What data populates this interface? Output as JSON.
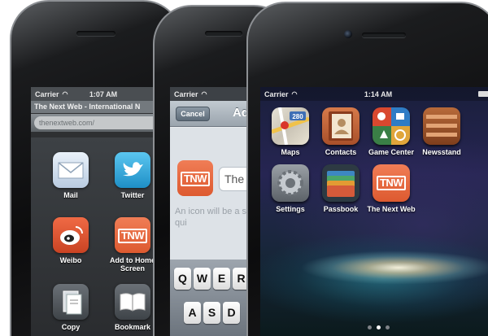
{
  "phone1": {
    "status": {
      "carrier": "Carrier",
      "time": "1:07 AM"
    },
    "page_title": "The Next Web - International N",
    "url": "thenextweb.com/",
    "share_items": [
      {
        "id": "mail",
        "label": "Mail",
        "icon": "mail-icon"
      },
      {
        "id": "twitter",
        "label": "Twitter",
        "icon": "twitter-icon"
      },
      {
        "id": "weibo",
        "label": "Weibo",
        "icon": "weibo-icon"
      },
      {
        "id": "add-home",
        "label": "Add to Home Screen",
        "icon": "tnw-icon"
      },
      {
        "id": "copy",
        "label": "Copy",
        "icon": "copy-icon"
      },
      {
        "id": "bookmark",
        "label": "Bookmark",
        "icon": "bookmark-icon"
      }
    ]
  },
  "phone2": {
    "status": {
      "carrier": "Carrier"
    },
    "cancel": "Cancel",
    "title": "Ad",
    "name_field": "The T",
    "hint": "An icon will be a so you can qui",
    "keys_row1": [
      "Q",
      "W",
      "E",
      "R"
    ],
    "keys_row2": [
      "A",
      "S",
      "D"
    ]
  },
  "phone3": {
    "status": {
      "carrier": "Carrier",
      "time": "1:14 AM"
    },
    "apps": [
      {
        "id": "maps",
        "label": "Maps",
        "icon": "maps-icon",
        "badge": "280"
      },
      {
        "id": "contacts",
        "label": "Contacts",
        "icon": "contacts-icon"
      },
      {
        "id": "game-center",
        "label": "Game Center",
        "icon": "game-center-icon"
      },
      {
        "id": "newsstand",
        "label": "Newsstand",
        "icon": "newsstand-icon"
      },
      {
        "id": "settings",
        "label": "Settings",
        "icon": "settings-icon"
      },
      {
        "id": "passbook",
        "label": "Passbook",
        "icon": "passbook-icon"
      },
      {
        "id": "tnw",
        "label": "The Next Web",
        "icon": "tnw-icon"
      }
    ],
    "page_count": 3,
    "active_page": 1
  },
  "tnw_logo": "TNW",
  "colors": {
    "tnw_orange": "#e8663f",
    "phone_body": "#0c0c0d"
  }
}
